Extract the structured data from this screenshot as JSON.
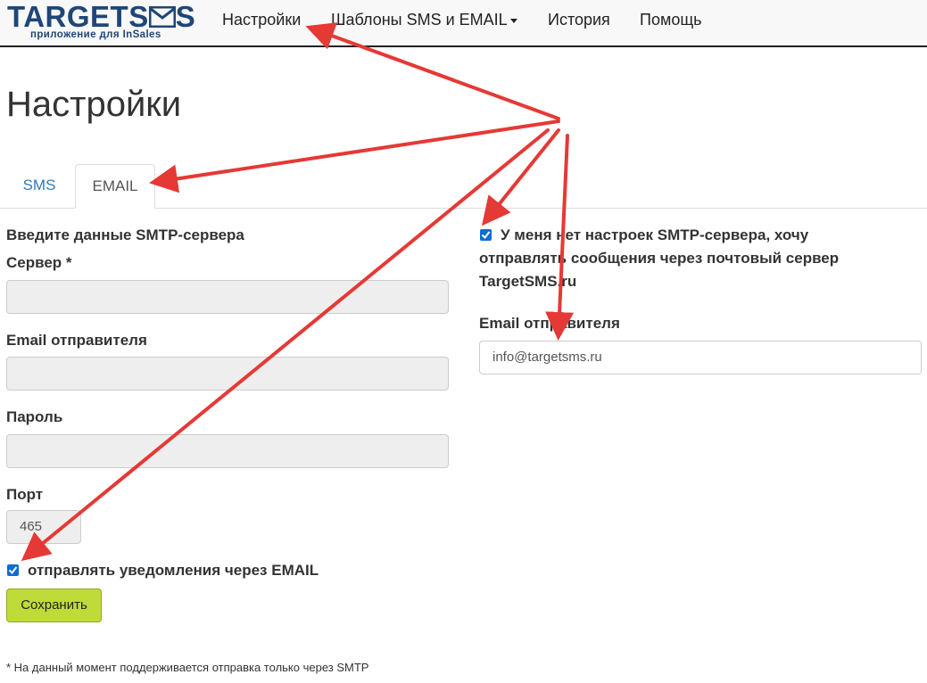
{
  "brand": {
    "logo_text_left": "TARGETS",
    "logo_text_right": "S",
    "logo_subtitle": "приложение для InSales",
    "accent_color": "#1e4677"
  },
  "nav": {
    "items": [
      {
        "label": "Настройки"
      },
      {
        "label": "Шаблоны SMS и EMAIL",
        "has_dropdown": true
      },
      {
        "label": "История"
      },
      {
        "label": "Помощь"
      }
    ]
  },
  "page": {
    "title": "Настройки",
    "tabs": [
      {
        "label": "SMS",
        "active": false
      },
      {
        "label": "EMAIL",
        "active": true
      }
    ]
  },
  "smtp_form": {
    "heading": "Введите данные SMTP-сервера",
    "server_label": "Сервер *",
    "server_value": "",
    "email_label": "Email отправителя",
    "email_value": "",
    "password_label": "Пароль",
    "password_value": "",
    "port_label": "Порт",
    "port_value": "465",
    "send_email_checkbox": {
      "checked": true,
      "label": "отправлять уведомления через EMAIL"
    },
    "save_label": "Сохранить",
    "save_color": "#bedb39"
  },
  "alt_option": {
    "checkbox_checked": true,
    "checkbox_label": "У меня нет настроек SMTP-сервера, хочу отправлять сообщения через почтовый сервер TargetSMS.ru",
    "email_label": "Email отправителя",
    "email_value": "info@targetsms.ru"
  },
  "footnote": "* На данный момент поддерживается отправка только через SMTP",
  "annotation_arrow_color": "#e53935"
}
